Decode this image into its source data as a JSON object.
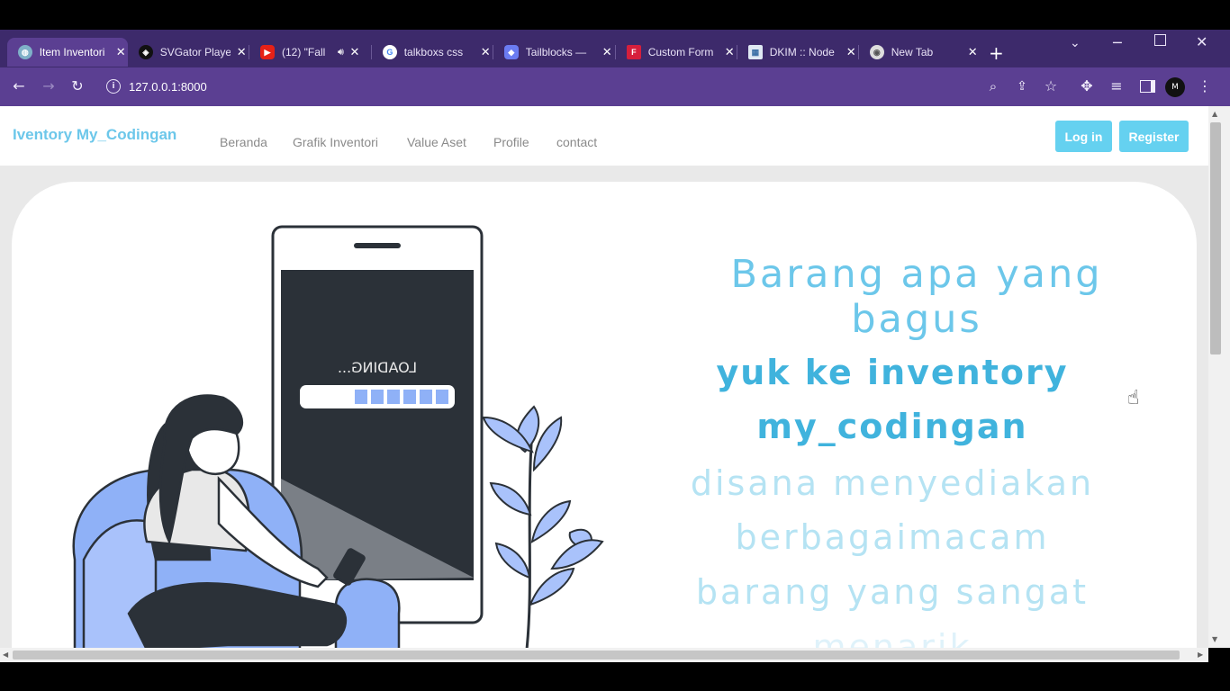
{
  "browser": {
    "tabs": [
      {
        "title": "Item Inventori",
        "favicon": "globe-icon",
        "active": true
      },
      {
        "title": "SVGator Player",
        "favicon": "svgator-icon",
        "active": false
      },
      {
        "title": "(12) \"Fall",
        "favicon": "youtube-icon",
        "active": false
      },
      {
        "title": "talkboxs css",
        "favicon": "google-icon",
        "active": false
      },
      {
        "title": "Tailblocks —",
        "favicon": "tailblocks-icon",
        "active": false
      },
      {
        "title": "Custom Form",
        "favicon": "form-icon",
        "active": false
      },
      {
        "title": "DKIM :: Node",
        "favicon": "dkim-icon",
        "active": false
      },
      {
        "title": "New Tab",
        "favicon": "chrome-icon",
        "active": false
      }
    ],
    "url": "127.0.0.1:8000",
    "profile_initial": "M",
    "colors": {
      "frame": "#3d2a6b",
      "toolbar": "#5b3f92"
    }
  },
  "navbar": {
    "brand": "Iventory My_Codingan",
    "links": [
      "Beranda",
      "Grafik Inventori",
      "Value Aset",
      "Profile",
      "contact"
    ],
    "login_label": "Log in",
    "register_label": "Register",
    "accent_color": "#65d1f0"
  },
  "hero": {
    "headline": "Barang apa yang bagus",
    "subline_1": "yuk ke inventory",
    "subline_2": "my_codingan",
    "desc_1": "disana menyediakan",
    "desc_2": "berbagaimacam",
    "desc_3": "barang yang sangat",
    "desc_4": "menarik",
    "illustration": {
      "loading_text": "LOADING...",
      "colors": {
        "dark": "#2b3138",
        "blue": "#8fb1f7",
        "light_blue": "#a9c2fb"
      }
    }
  }
}
